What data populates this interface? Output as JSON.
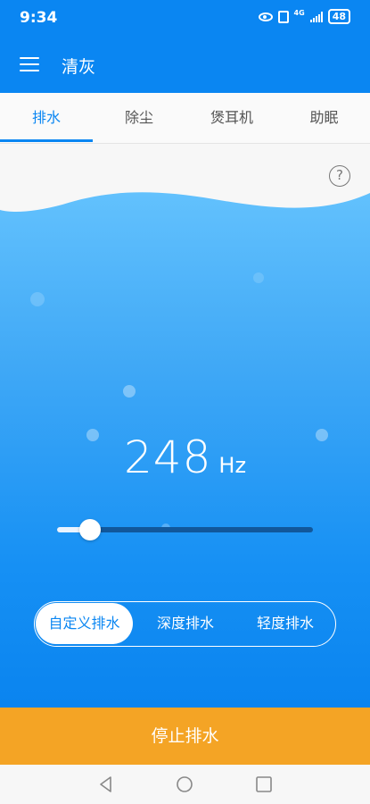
{
  "status_bar": {
    "time": "9:34",
    "network": "4G",
    "battery": "48",
    "icons": [
      "eye-icon",
      "vibrate-icon",
      "signal-icon",
      "battery-icon"
    ]
  },
  "app_bar": {
    "title": "清灰",
    "menu_icon": "hamburger-menu-icon"
  },
  "tabs": [
    {
      "label": "排水",
      "active": true
    },
    {
      "label": "除尘",
      "active": false
    },
    {
      "label": "煲耳机",
      "active": false
    },
    {
      "label": "助眠",
      "active": false
    }
  ],
  "main": {
    "help_icon": "?",
    "frequency_value": "248",
    "frequency_unit": "Hz",
    "slider_level": 0.13
  },
  "modes": [
    {
      "label": "自定义排水",
      "active": true
    },
    {
      "label": "深度排水",
      "active": false
    },
    {
      "label": "轻度排水",
      "active": false
    }
  ],
  "stop_button_label": "停止排水",
  "colors": {
    "primary": "#0a86f2",
    "accent_button": "#f4a425",
    "slider_track": "#11579b"
  },
  "nav_bar": [
    "back-icon",
    "home-icon",
    "recents-icon"
  ]
}
